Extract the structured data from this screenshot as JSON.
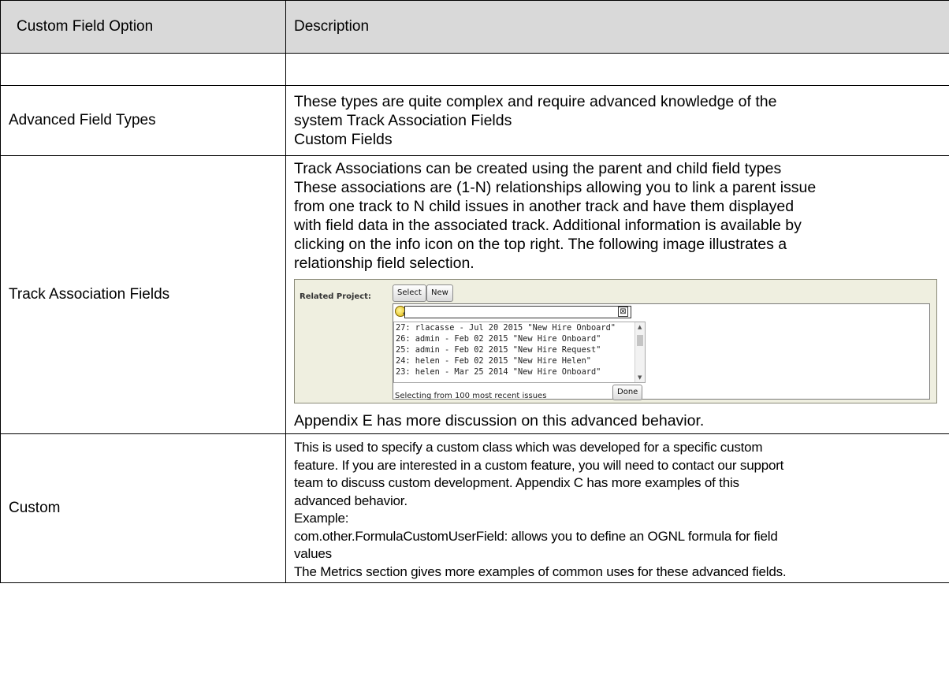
{
  "header": {
    "col1": "Custom Field Option",
    "col2": "Description"
  },
  "rows": {
    "advanced": {
      "option": "Advanced Field Types",
      "lines": [
        "These types are quite complex and require advanced knowledge of the",
        "system Track Association Fields",
        "Custom Fields"
      ]
    },
    "track": {
      "option": "Track Association Fields",
      "lines": [
        "Track Associations can be created using the parent and child field types",
        "These associations are (1-N) relationships allowing you to link a parent issue",
        "from one track to N child issues in another track and have them displayed",
        "with field data in the associated track. Additional information is available by",
        "clicking on the info icon on the top right. The following image illustrates a",
        "relationship field selection."
      ],
      "after": "Appendix E has more discussion on this advanced behavior."
    },
    "custom": {
      "option": "Custom",
      "lines": [
        "This is used to specify a custom class which was developed for a specific custom",
        "feature. If you are interested in a custom feature, you will need to contact our support",
        "team to discuss custom development. Appendix C has more examples of this",
        "advanced behavior.",
        "Example:",
        "com.other.FormulaCustomUserField: allows you to define an OGNL formula for field",
        "values",
        "The Metrics section gives more examples of common uses for these advanced fields."
      ]
    }
  },
  "screenshot": {
    "label": "Related Project:",
    "select_button": "Select",
    "new_button": "New",
    "search_value": "",
    "clear_glyph": "⊠",
    "items": [
      "27: rlacasse - Jul 20 2015 \"New Hire Onboard\"",
      "26: admin - Feb 02 2015 \"New Hire Onboard\"",
      "25: admin - Feb 02 2015 \"New Hire Request\"",
      "24: helen - Feb 02 2015 \"New Hire Helen\"",
      "23: helen - Mar 25 2014 \"New Hire Onboard\""
    ],
    "status": "Selecting from 100 most recent issues",
    "done_button": "Done",
    "icons": {
      "search": "search-icon",
      "clear": "clear-icon"
    }
  }
}
